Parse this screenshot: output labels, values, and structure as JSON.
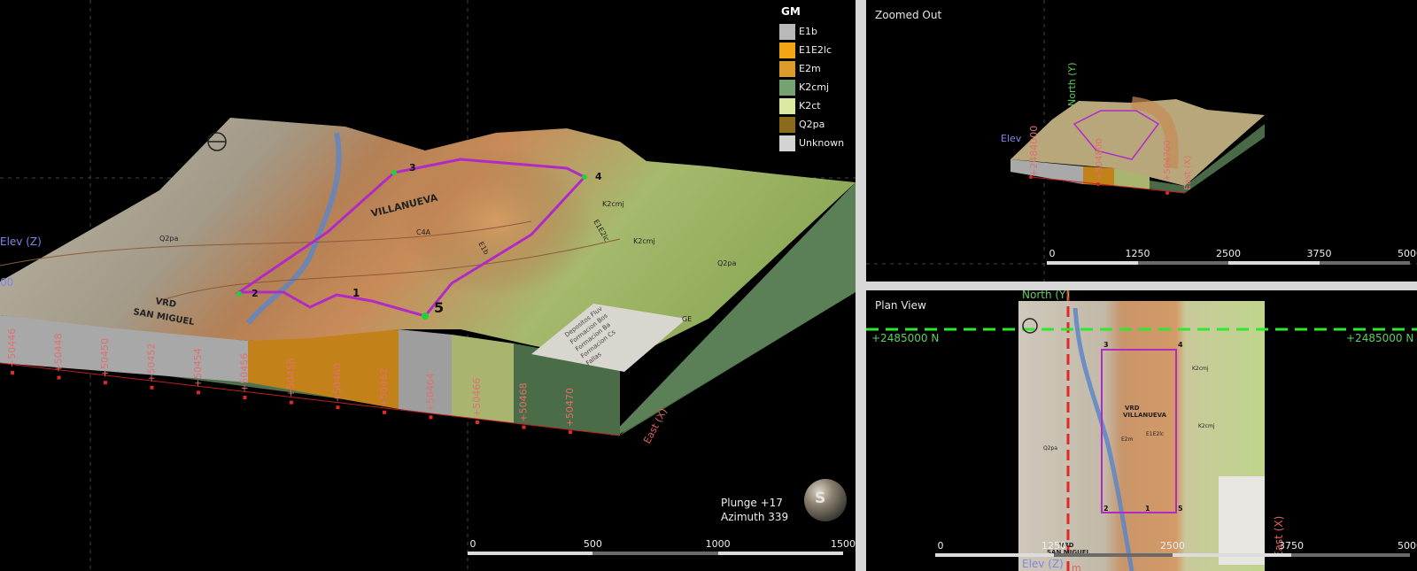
{
  "main_view": {
    "legend": {
      "title": "GM",
      "items": [
        {
          "label": "E1b",
          "color": "#b9b9b9"
        },
        {
          "label": "E1E2lc",
          "color": "#f3a515"
        },
        {
          "label": "E2m",
          "color": "#dd9b2a"
        },
        {
          "label": "K2cmj",
          "color": "#76a271"
        },
        {
          "label": "K2ct",
          "color": "#dbe9a2"
        },
        {
          "label": "Q2pa",
          "color": "#8b6a1b"
        },
        {
          "label": "Unknown",
          "color": "#d3d3d3"
        }
      ]
    },
    "orientation": {
      "plunge": "Plunge +17",
      "azimuth": "Azimuth 339"
    },
    "globe_label": "S",
    "scale_ticks": [
      "0",
      "500",
      "1000",
      "1500"
    ],
    "axis_elev": "Elev (Z)",
    "axis_elev_tick": "00",
    "axis_east": "East (X)",
    "east_ticks": [
      "+50446",
      "+50448",
      "+50450",
      "+50452",
      "+50454",
      "+50456",
      "+50458",
      "+50460",
      "+50462",
      "+50464",
      "+50466",
      "+50468",
      "+50470"
    ],
    "map_labels": [
      "VILLANUEVA",
      "VRD",
      "SAN MIGUEL",
      "Q2pa",
      "E1b",
      "K2cmj",
      "K2cmj",
      "E1E2lc",
      "C4A",
      "Q2pa"
    ],
    "vertex_labels": [
      "1",
      "2",
      "3",
      "4",
      "5"
    ],
    "map_legend_title": "GE",
    "map_legend_lines": [
      "Depositos Fluv",
      "Formacion Bos",
      "Formacion Ba",
      "Formacion Cs",
      "Fallas"
    ]
  },
  "zoom_view": {
    "title": "Zoomed Out",
    "scale_ticks": [
      "0",
      "1250",
      "2500",
      "3750",
      "5000"
    ],
    "axis_north": "North (Y)",
    "axis_elev": "Elev",
    "axis_east": "East (X)",
    "north_tick": "+2484000",
    "east_tick_a": "+5046",
    "east_tick_b": "+504800",
    "east_tick_c": "+50460",
    "east_tick_d": "+504700"
  },
  "plan_view": {
    "title": "Plan View",
    "north_label_left": "+2485000 N",
    "north_label_right": "+2485000 N",
    "axis_north": "North (Y)",
    "axis_east": "East (X)",
    "axis_elev": "Elev (Z)",
    "axis_unit": "m",
    "scale_ticks": [
      "0",
      "1250",
      "2500",
      "3750",
      "5000"
    ],
    "map_labels": [
      "VRD",
      "VILLANUEVA",
      "E1E2lc",
      "E2m",
      "K2cmj",
      "K2cmj",
      "Q2pa",
      "VRD",
      "SAN MIGUEL"
    ],
    "vertex_labels": [
      "3",
      "4",
      "2",
      "1",
      "5"
    ]
  }
}
